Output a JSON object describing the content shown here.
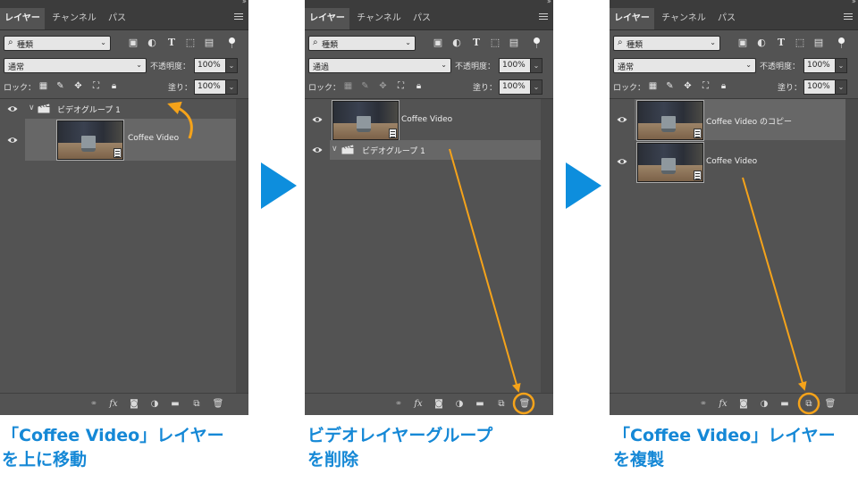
{
  "panels": [
    {
      "tabs": [
        "レイヤー",
        "チャンネル",
        "パス"
      ],
      "filter_kind": "種類",
      "blend_mode": "通常",
      "opacity_label": "不透明度：",
      "opacity_value": "100%",
      "lock_label": "ロック：",
      "fill_label": "塗り：",
      "fill_value": "100%",
      "group_name": "ビデオグループ 1",
      "video_name": "Coffee Video"
    },
    {
      "tabs": [
        "レイヤー",
        "チャンネル",
        "パス"
      ],
      "filter_kind": "種類",
      "blend_mode": "通過",
      "opacity_label": "不透明度：",
      "opacity_value": "100%",
      "lock_label": "ロック：",
      "fill_label": "塗り：",
      "fill_value": "100%",
      "video_name": "Coffee Video",
      "group_name": "ビデオグループ 1"
    },
    {
      "tabs": [
        "レイヤー",
        "チャンネル",
        "パス"
      ],
      "filter_kind": "種類",
      "blend_mode": "通常",
      "opacity_label": "不透明度：",
      "opacity_value": "100%",
      "lock_label": "ロック：",
      "fill_label": "塗り：",
      "fill_value": "100%",
      "copy_name": "Coffee Video のコピー",
      "video_name": "Coffee Video"
    }
  ],
  "captions": [
    {
      "line1": "「Coffee Video」レイヤー",
      "line2": "を上に移動"
    },
    {
      "line1": "ビデオレイヤーグループ",
      "line2": "を削除"
    },
    {
      "line1": "「Coffee Video」レイヤー",
      "line2": "を複製"
    }
  ],
  "icons": {
    "search": "search-icon",
    "eye": "eye-icon",
    "film": "film-icon",
    "clapper": "clapperboard-icon",
    "trash": "trash-icon",
    "new_layer": "new-layer-icon"
  },
  "colors": {
    "panel_bg": "#535353",
    "tab_bar": "#3c3c3c",
    "accent_arrow": "#f5a31a",
    "step_arrow": "#0d8edd",
    "caption": "#1588d6",
    "selected_layer": "#676767"
  }
}
